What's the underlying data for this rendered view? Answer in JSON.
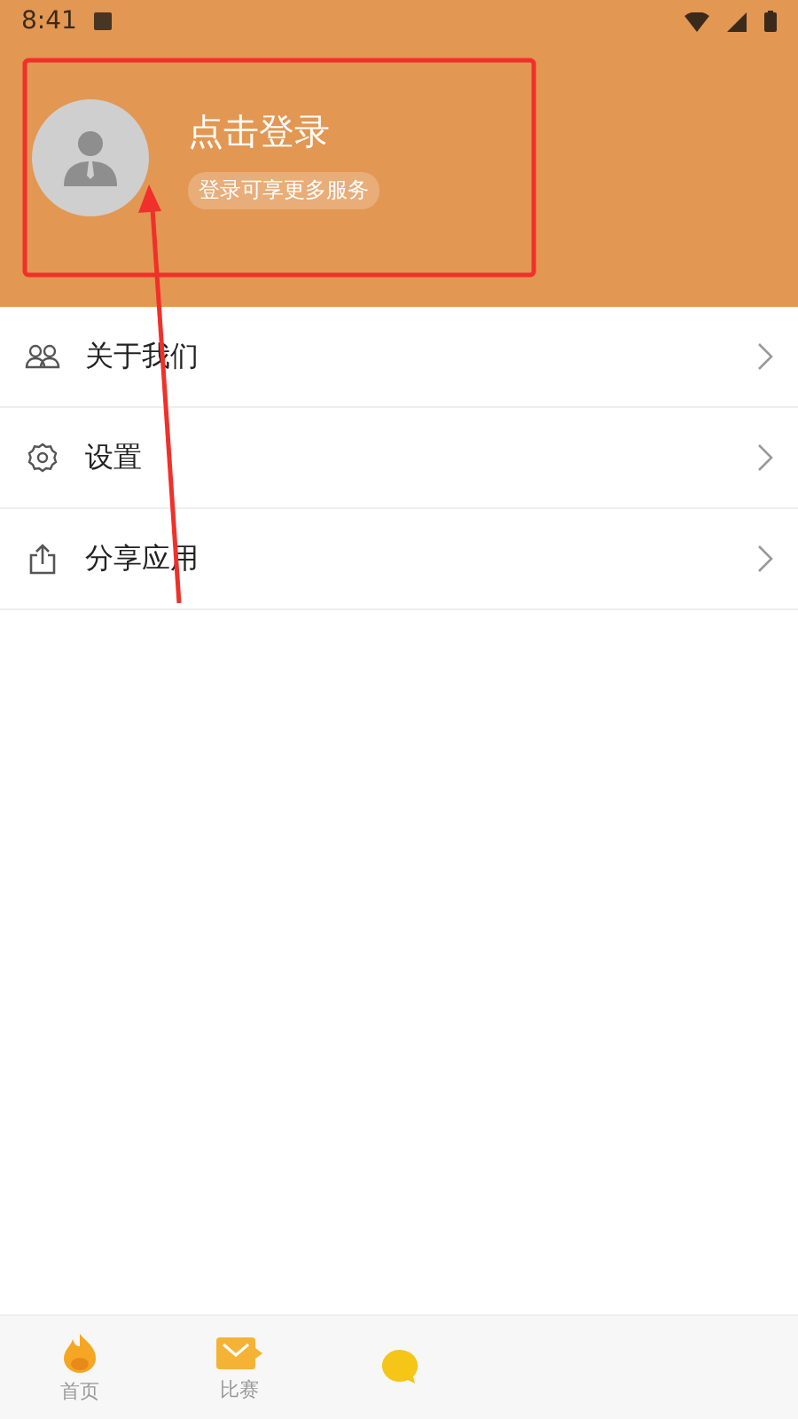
{
  "status_bar": {
    "time": "8:41"
  },
  "profile": {
    "title": "点击登录",
    "subtitle": "登录可享更多服务"
  },
  "menu": [
    {
      "kind": "about",
      "label": "关于我们"
    },
    {
      "kind": "settings",
      "label": "设置"
    },
    {
      "kind": "share",
      "label": "分享应用"
    }
  ],
  "tab_bar": [
    {
      "kind": "home",
      "label": "首页"
    },
    {
      "kind": "match",
      "label": "比赛"
    },
    {
      "kind": "chat"
    }
  ],
  "annotation": {
    "highlight": true,
    "arrow": true
  }
}
